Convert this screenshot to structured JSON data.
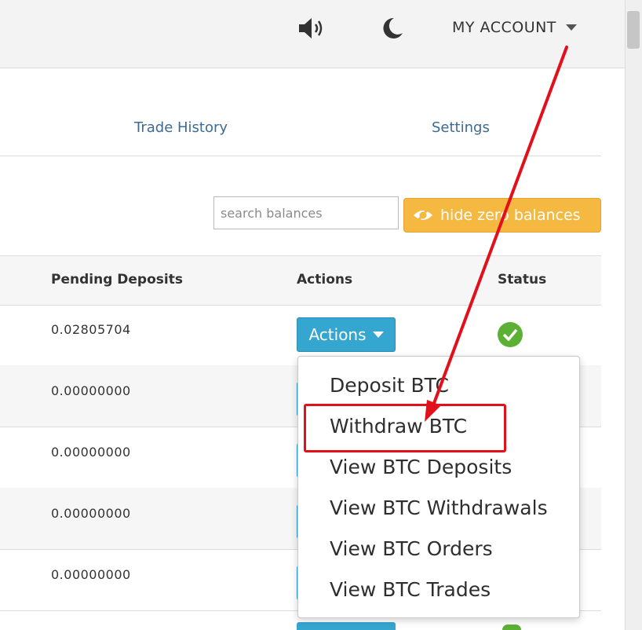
{
  "header": {
    "account_label": "MY ACCOUNT"
  },
  "nav": {
    "trade_history": "Trade History",
    "settings": "Settings"
  },
  "filters": {
    "search_placeholder": "search balances",
    "hide_zero_label": "hide zero balances"
  },
  "table": {
    "columns": {
      "pending": "Pending Deposits",
      "actions": "Actions",
      "status": "Status"
    },
    "rows": [
      {
        "pending": "0.02805704"
      },
      {
        "pending": "0.00000000"
      },
      {
        "pending": "0.00000000"
      },
      {
        "pending": "0.00000000"
      },
      {
        "pending": "0.00000000"
      }
    ],
    "actions_button": "Actions"
  },
  "dropdown": {
    "items": [
      "Deposit BTC",
      "Withdraw BTC",
      "View BTC Deposits",
      "View BTC Withdrawals",
      "View BTC Orders",
      "View BTC Trades"
    ],
    "highlighted_index": 1
  },
  "colors": {
    "accent_blue": "#35a6cf",
    "hide_button": "#f5b840",
    "annotation_red": "#e2101b",
    "status_green": "#5cb135"
  },
  "icons": [
    "speaker-icon",
    "moon-icon",
    "chevron-down-icon",
    "eye-icon",
    "check-circle-icon"
  ]
}
